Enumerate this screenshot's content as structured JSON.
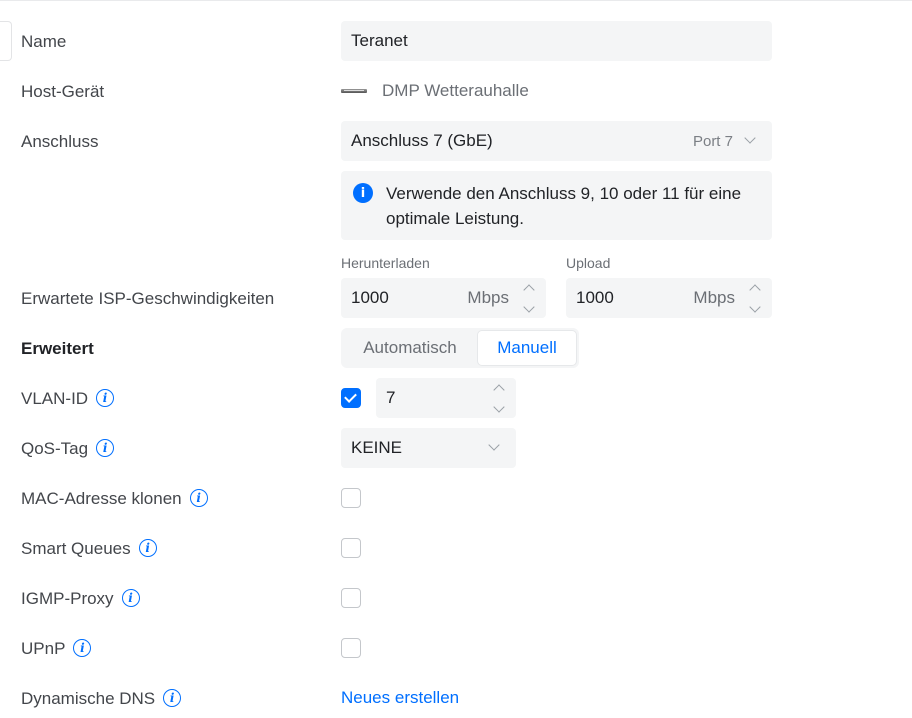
{
  "form": {
    "name": {
      "label": "Name",
      "value": "Teranet"
    },
    "host_device": {
      "label": "Host-Gerät",
      "value": "DMP Wetterauhalle",
      "icon": "device-icon"
    },
    "port": {
      "label": "Anschluss",
      "value": "Anschluss 7 (GbE)",
      "hint": "Port 7"
    },
    "notice": {
      "text": "Verwende den Anschluss 9, 10 oder 11 für eine optimale Leistung.",
      "icon": "info-icon"
    },
    "isp_speeds": {
      "label": "Erwartete ISP-Geschwindigkeiten",
      "download": {
        "label": "Herunterladen",
        "value": "1000",
        "unit": "Mbps"
      },
      "upload": {
        "label": "Upload",
        "value": "1000",
        "unit": "Mbps"
      }
    },
    "advanced": {
      "label": "Erweitert",
      "options": [
        "Automatisch",
        "Manuell"
      ],
      "selected": "Manuell"
    },
    "vlan_id": {
      "label": "VLAN-ID",
      "checked": true,
      "value": "7"
    },
    "qos_tag": {
      "label": "QoS-Tag",
      "value": "KEINE"
    },
    "mac_clone": {
      "label": "MAC-Adresse klonen",
      "checked": false
    },
    "smart_queues": {
      "label": "Smart Queues",
      "checked": false
    },
    "igmp_proxy": {
      "label": "IGMP-Proxy",
      "checked": false
    },
    "upnp": {
      "label": "UPnP",
      "checked": false
    },
    "dynamic_dns": {
      "label": "Dynamische DNS",
      "action": "Neues erstellen"
    }
  },
  "colors": {
    "accent": "#006fff",
    "field_bg": "#f4f5f6",
    "label_text": "#43464b"
  }
}
